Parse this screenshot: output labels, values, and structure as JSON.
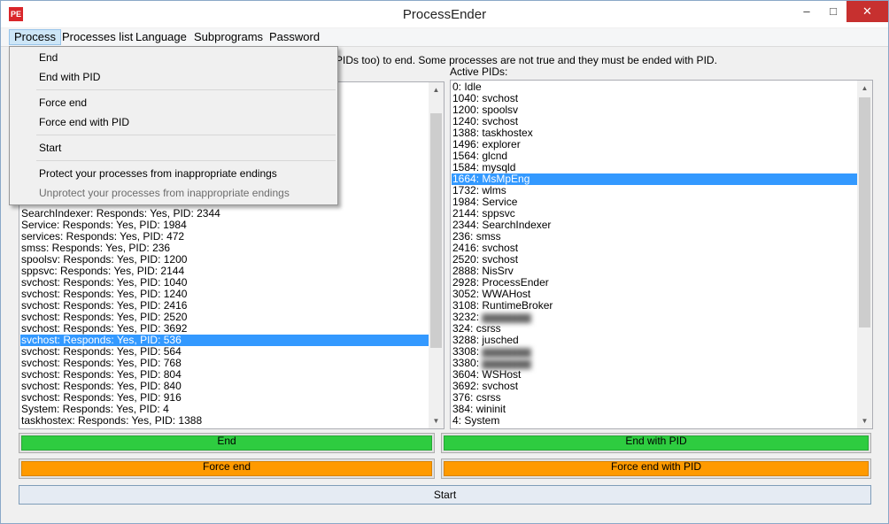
{
  "window": {
    "title": "ProcessEnder",
    "icon_text": "PE",
    "controls": {
      "minimize": "–",
      "maximize": "□",
      "close": "✕"
    }
  },
  "menubar": [
    "Process",
    "Processes list",
    "Language",
    "Subprograms",
    "Password"
  ],
  "process_menu": {
    "end": "End",
    "end_pid": "End with PID",
    "force_end": "Force end",
    "force_end_pid": "Force end with PID",
    "start": "Start",
    "protect": "Protect your processes from inappropriate endings",
    "unprotect": "Unprotect your processes from inappropriate endings"
  },
  "info_text": "PIDs too) to end. Some processes are not true and they must be ended with PID.",
  "active_pids_label": "Active PIDs:",
  "left_list": [
    "SearchIndexer: Responds: Yes, PID: 2344",
    "Service: Responds: Yes, PID: 1984",
    "services: Responds: Yes, PID: 472",
    "smss: Responds: Yes, PID: 236",
    "spoolsv: Responds: Yes, PID: 1200",
    "sppsvc: Responds: Yes, PID: 2144",
    "svchost: Responds: Yes, PID: 1040",
    "svchost: Responds: Yes, PID: 1240",
    "svchost: Responds: Yes, PID: 2416",
    "svchost: Responds: Yes, PID: 2520",
    "svchost: Responds: Yes, PID: 3692",
    "svchost: Responds: Yes, PID: 536",
    "svchost: Responds: Yes, PID: 564",
    "svchost: Responds: Yes, PID: 768",
    "svchost: Responds: Yes, PID: 804",
    "svchost: Responds: Yes, PID: 840",
    "svchost: Responds: Yes, PID: 916",
    "System: Responds: Yes, PID: 4",
    "taskhostex: Responds: Yes, PID: 1388"
  ],
  "right_list": [
    "0: Idle",
    "1040: svchost",
    "1200: spoolsv",
    "1240: svchost",
    "1388: taskhostex",
    "1496: explorer",
    "1564: glcnd",
    "1584: mysqld",
    "1664: MsMpEng",
    "1732: wlms",
    "1984: Service",
    "2144: sppsvc",
    "2344: SearchIndexer",
    "236: smss",
    "2416: svchost",
    "2520: svchost",
    "2888: NisSrv",
    "2928: ProcessEnder",
    "3052: WWAHost",
    "3108: RuntimeBroker",
    "3232: ",
    "324: csrss",
    "3288: jusched",
    "3308: ",
    "3380: ",
    "3604: WSHost",
    "3692: svchost",
    "376: csrss",
    "384: wininit",
    "4: System"
  ],
  "buttons": {
    "end": "End",
    "end_pid": "End with PID",
    "force_end": "Force end",
    "force_end_pid": "Force end with PID",
    "start": "Start"
  },
  "colors": {
    "green": "#2ecc40",
    "orange": "#ff9a00",
    "selection": "#3399ff",
    "close": "#c7302f"
  }
}
